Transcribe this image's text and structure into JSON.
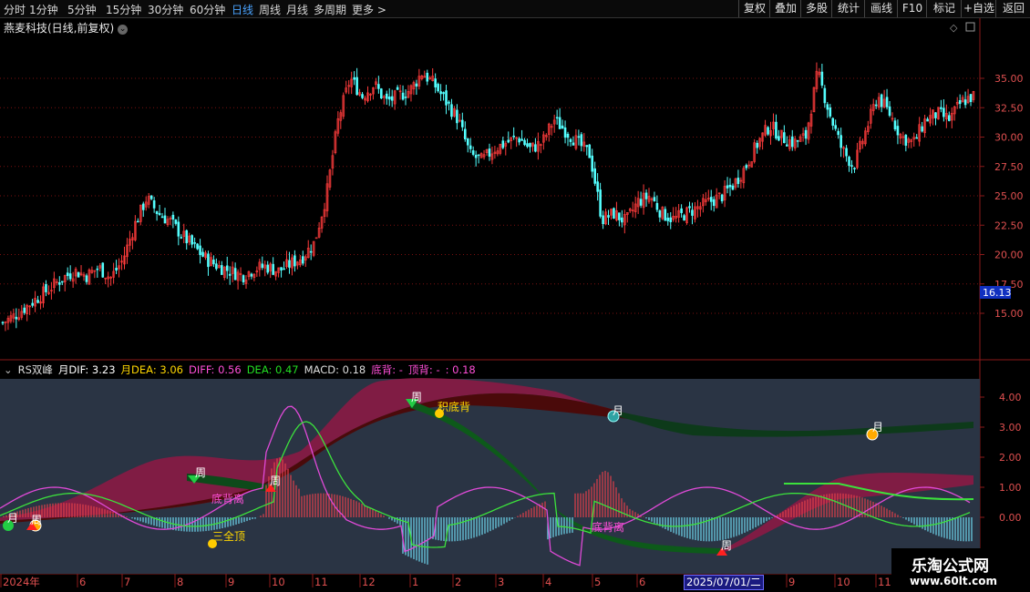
{
  "toolbar": {
    "periods": [
      "分时",
      "1分钟",
      "5分钟",
      "15分钟",
      "30分钟",
      "60分钟",
      "日线",
      "周线",
      "月线",
      "多周期",
      "更多 >"
    ],
    "active_period": "日线",
    "right_buttons": [
      "复权",
      "叠加",
      "多股",
      "统计",
      "画线",
      "F10",
      "标记",
      "+自选",
      "返回"
    ]
  },
  "main_chart": {
    "title": "燕麦科技(日线,前复权)",
    "price_ticks": [
      "35.00",
      "32.50",
      "30.00",
      "27.50",
      "25.00",
      "22.50",
      "20.00",
      "17.50",
      "15.00"
    ],
    "current_price_label": "16.13"
  },
  "indicator": {
    "name": "RS双峰",
    "month_dif": "月DIF: 3.23",
    "month_dea": "月DEA: 3.06",
    "diff": "DIFF: 0.56",
    "dea": "DEA: 0.47",
    "macd": "MACD: 0.18",
    "bottom_div": "底背: -",
    "top_div": "顶背: -",
    "last": ": 0.18",
    "ticks": [
      "4.00",
      "3.00",
      "2.00",
      "1.00",
      "0.00"
    ],
    "labels": {
      "week1": "周",
      "week2": "周",
      "week3": "周",
      "week4": "周",
      "week5": "周",
      "month1": "月",
      "month2": "月",
      "month3": "月",
      "ji_dibei": "积底背",
      "dibeili1": "底背离",
      "dibeili2": "底背离",
      "sanquanding": "三全顶"
    }
  },
  "x_axis": {
    "labels": [
      "2024年",
      "6",
      "7",
      "8",
      "9",
      "10",
      "11",
      "12",
      "1",
      "2",
      "3",
      "4",
      "5",
      "6",
      "2025/07/01/二",
      "9",
      "10",
      "11"
    ]
  },
  "watermark": {
    "line1": "乐淘公式网",
    "line2": "www.60lt.com"
  },
  "chart_data": {
    "type": "candlestick",
    "title": "燕麦科技(日线,前复权)",
    "ylim": [
      13.0,
      38.5
    ],
    "x_labels": [
      "2024年",
      "6",
      "7",
      "8",
      "9",
      "10",
      "11",
      "12",
      "1",
      "2",
      "3",
      "4",
      "5",
      "6",
      "2025/07/01/二",
      "9",
      "10",
      "11"
    ],
    "close_path": [
      14.2,
      14.8,
      15.6,
      16.4,
      17.2,
      18.0,
      18.6,
      18.2,
      18.9,
      18.0,
      19.5,
      22.5,
      24.8,
      23.5,
      22.8,
      21.6,
      20.6,
      19.6,
      19.0,
      18.6,
      18.2,
      18.8,
      19.0,
      18.6,
      19.2,
      19.8,
      21.0,
      25.0,
      31.5,
      35.0,
      33.5,
      34.5,
      33.0,
      33.5,
      34.0,
      35.5,
      34.5,
      33.0,
      31.5,
      28.5,
      28.0,
      29.0,
      29.5,
      30.0,
      29.0,
      29.5,
      31.5,
      30.5,
      29.5,
      28.5,
      23.0,
      23.5,
      22.8,
      24.5,
      25.0,
      23.5,
      23.0,
      23.5,
      24.0,
      24.5,
      25.0,
      26.0,
      27.5,
      29.5,
      31.0,
      30.0,
      29.5,
      30.0,
      35.5,
      32.0,
      29.0,
      27.5,
      30.5,
      33.5,
      32.0,
      30.0,
      29.5,
      31.5,
      32.0,
      31.5,
      33.0,
      33.5
    ],
    "indicator": {
      "diff_last": 0.56,
      "dea_last": 0.47,
      "macd_last": 0.18,
      "month_dif": 3.23,
      "month_dea": 3.06,
      "ylim": [
        -1.8,
        4.8
      ]
    }
  }
}
